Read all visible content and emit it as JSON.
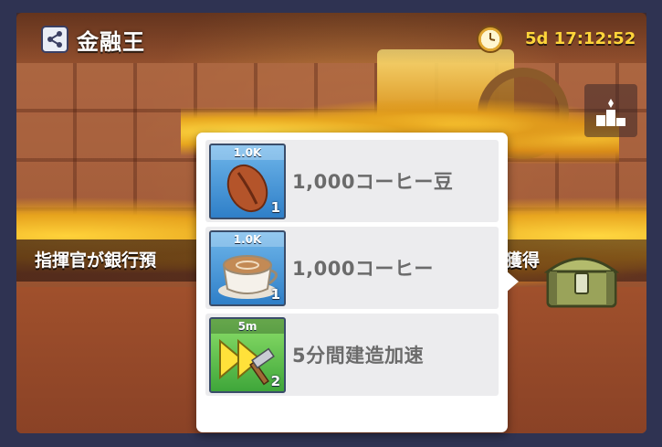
{
  "header": {
    "title": "金融王",
    "timer": "5d 17:12:52"
  },
  "banner": {
    "text_left": "指揮官が銀行預",
    "text_right": "獲得"
  },
  "popup": {
    "items": [
      {
        "tag": "1.0K",
        "count": "1",
        "label": "1,000コーヒー豆",
        "icon": "coffee-bean-icon"
      },
      {
        "tag": "1.0K",
        "count": "1",
        "label": "1,000コーヒー",
        "icon": "coffee-cup-icon"
      },
      {
        "tag": "5m",
        "count": "2",
        "label": "5分間建造加速",
        "icon": "build-speedup-icon"
      }
    ]
  },
  "colors": {
    "timer": "#ffd53a",
    "item_label": "#6b6b6b",
    "frame": "#2f3352"
  }
}
